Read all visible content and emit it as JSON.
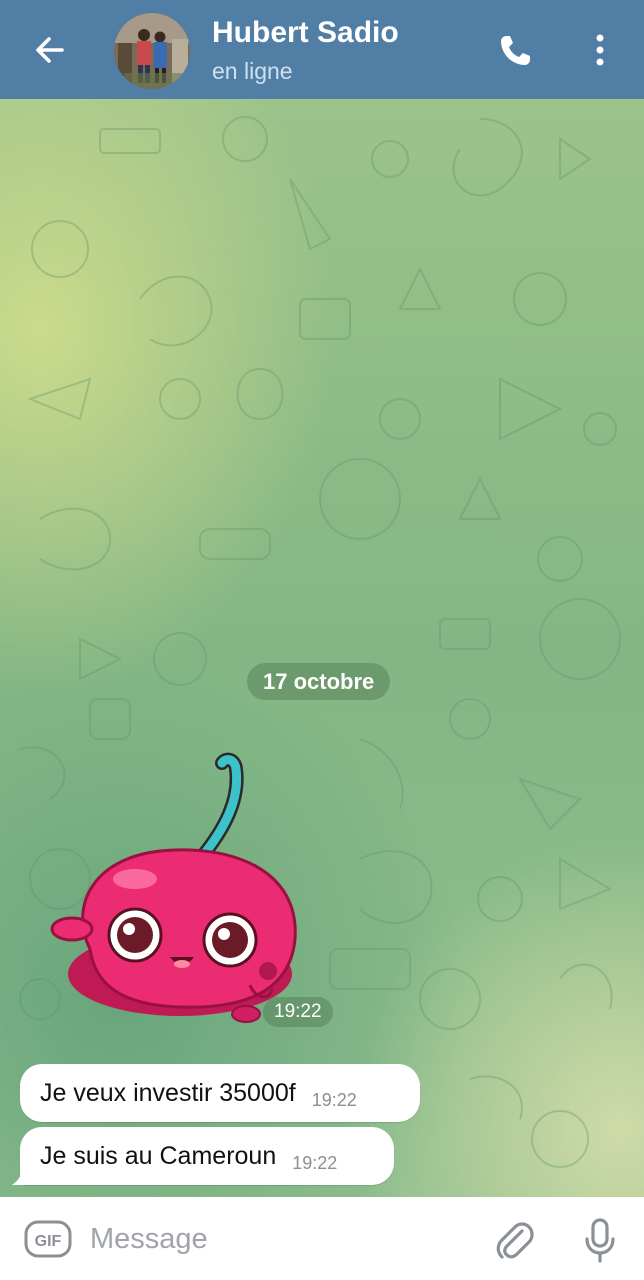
{
  "header": {
    "contact_name": "Hubert Sadio",
    "status": "en ligne",
    "back_icon": "arrow-left-icon",
    "call_icon": "phone-icon",
    "menu_icon": "more-vertical-icon",
    "background_color": "#517ea5"
  },
  "chat": {
    "date_separator": "17 octobre",
    "sticker": {
      "description_icon": "pink-cherry-sticker",
      "time": "19:22"
    },
    "messages": [
      {
        "text": "Je veux investir 35000f",
        "time": "19:22"
      },
      {
        "text": "Je suis au Cameroun",
        "time": "19:22"
      }
    ]
  },
  "composer": {
    "gif_label": "GIF",
    "placeholder": "Message",
    "attach_icon": "paperclip-icon",
    "mic_icon": "microphone-icon"
  }
}
